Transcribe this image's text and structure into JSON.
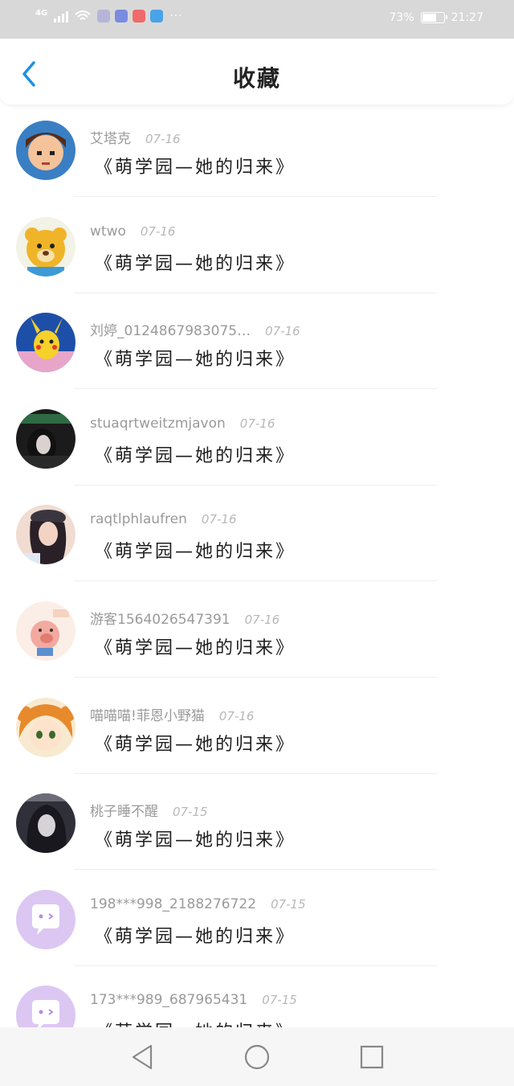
{
  "status_bar": {
    "network": "4G",
    "battery_percent": "73%",
    "battery_level": 0.73,
    "time": "21:27",
    "apps": [
      {
        "icon": "sim-icon",
        "color": "#b5b5d8"
      },
      {
        "icon": "music-app-icon",
        "color": "#7a8be0"
      },
      {
        "icon": "book-app-icon",
        "color": "#ef6a6a"
      },
      {
        "icon": "browser-app-icon",
        "color": "#4aa3e8"
      }
    ],
    "overflow": "···"
  },
  "header": {
    "title": "收藏",
    "accent_color": "#1e90e8"
  },
  "items": [
    {
      "username": "艾塔克",
      "date": "07-16",
      "title": "《萌学园—她的归来》",
      "avatar": "pixel-boy-avatar",
      "colors": [
        "#3a7fc4",
        "#f4c39a"
      ]
    },
    {
      "username": "wtwo",
      "date": "07-16",
      "title": "《萌学园—她的归来》",
      "avatar": "bear-avatar",
      "colors": [
        "#f2f2e6",
        "#f0b429"
      ]
    },
    {
      "username": "刘婷_0124867983075…",
      "date": "07-16",
      "title": "《萌学园—她的归来》",
      "avatar": "pikachu-avatar",
      "colors": [
        "#1e4fa8",
        "#f6d12a"
      ]
    },
    {
      "username": "stuaqrtweitzmjavon",
      "date": "07-16",
      "title": "《萌学园—她的归来》",
      "avatar": "dark-girl-avatar",
      "colors": [
        "#1b1b1b",
        "#2e6a44"
      ]
    },
    {
      "username": "raqtlphlaufren",
      "date": "07-16",
      "title": "《萌学园—她的归来》",
      "avatar": "girl-hat-avatar",
      "colors": [
        "#f1dcd1",
        "#2a2028"
      ]
    },
    {
      "username": "游客1564026547391",
      "date": "07-16",
      "title": "《萌学园—她的归来》",
      "avatar": "pig-avatar",
      "colors": [
        "#fbeee7",
        "#f2a9a0"
      ]
    },
    {
      "username": "喵喵喵!菲恩小野猫",
      "date": "07-16",
      "title": "《萌学园—她的归来》",
      "avatar": "anime-girl-avatar",
      "colors": [
        "#f5d27a",
        "#e78a2c"
      ]
    },
    {
      "username": "桃子睡不醒",
      "date": "07-15",
      "title": "《萌学园—她的归来》",
      "avatar": "night-anime-avatar",
      "colors": [
        "#30303a",
        "#6c6c78"
      ]
    },
    {
      "username": "198***998_2188276722",
      "date": "07-15",
      "title": "《萌学园—她的归来》",
      "avatar": "default-chat-avatar",
      "colors": [
        "#dcc7f3",
        "#ffffff"
      ]
    },
    {
      "username": "173***989_687965431",
      "date": "07-15",
      "title": "《萌学园—她的归来》",
      "avatar": "default-chat-avatar",
      "colors": [
        "#dcc7f3",
        "#ffffff"
      ]
    }
  ]
}
